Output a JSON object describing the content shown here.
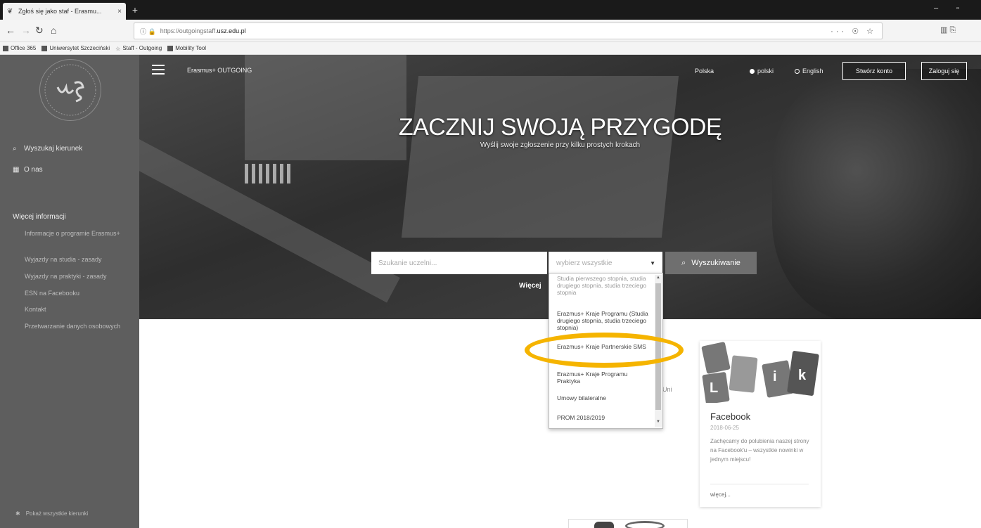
{
  "browser": {
    "tab_title": "Zgłoś się jako staf - Erasmu...",
    "tab_close": "×",
    "new_tab": "+",
    "url_prefix": "https://outgoingstaff.",
    "url_host": "usz.edu.pl",
    "url_actions": "··· ☉ ☆",
    "nav_right": "▥  ⎘",
    "window_controls": [
      "–",
      "▫"
    ],
    "bookmarks": [
      "Office 365",
      "Uniwersytet Szczeciński",
      "Staff - Outgoing",
      "Mobility Tool"
    ]
  },
  "sidebar": {
    "links": [
      {
        "icon": "search-icon",
        "glyph": "⌕",
        "label": "Wyszukaj kierunek"
      },
      {
        "icon": "building-icon",
        "glyph": "▦",
        "label": "O nas"
      }
    ],
    "section_title": "Więcej informacji",
    "sub_links": [
      "Informacje o programie Erasmus+",
      "Wyjazdy na studia - zasady",
      "Wyjazdy na praktyki - zasady",
      "ESN na Facebooku",
      "Kontakt",
      "Przetwarzanie danych osobowych"
    ],
    "footer": "Pokaż wszystkie kierunki"
  },
  "hero": {
    "app_name": "Erasmus+ OUTGOING",
    "languages": [
      {
        "label": "Polska",
        "selected": false
      },
      {
        "label": "polski",
        "selected": true
      },
      {
        "label": "English",
        "selected": false
      }
    ],
    "create_account": "Stwórz konto",
    "login": "Zaloguj się",
    "title": "ZACZNIJ SWOJĄ PRZYGODĘ",
    "subtitle": "Wyślij swoje zgłoszenie przy kilku prostych krokach"
  },
  "search": {
    "placeholder": "Szukanie uczelni...",
    "select_value": "wybierz wszystkie",
    "button_label": "Wyszukiwanie",
    "more_link": "Więcej"
  },
  "dropdown": {
    "items": [
      "Studia pierwszego stopnia, studia drugiego stopnia, studia trzeciego stopnia",
      "Erazmus+ Kraje Programu (Studia drugiego stopnia, studia trzeciego stopnia)",
      "Erazmus+ Kraje Partnerskie SMS",
      "Erazmus+ Kraje Programu Praktyka",
      "Umowy bilateralne",
      "PROM 2018/2019"
    ]
  },
  "cards": {
    "partial_text": "Uni",
    "facebook": {
      "title": "Facebook",
      "date": "2018-06-25",
      "text": "Zachęcamy do polubienia naszej strony na Facebook'u – wszystkie nowinki w jednym miejscu!",
      "more": "więcej..."
    }
  },
  "colors": {
    "sidebar_bg": "#5e5e5e",
    "highlight": "#f5b400",
    "search_button": "#6f6f6f"
  }
}
